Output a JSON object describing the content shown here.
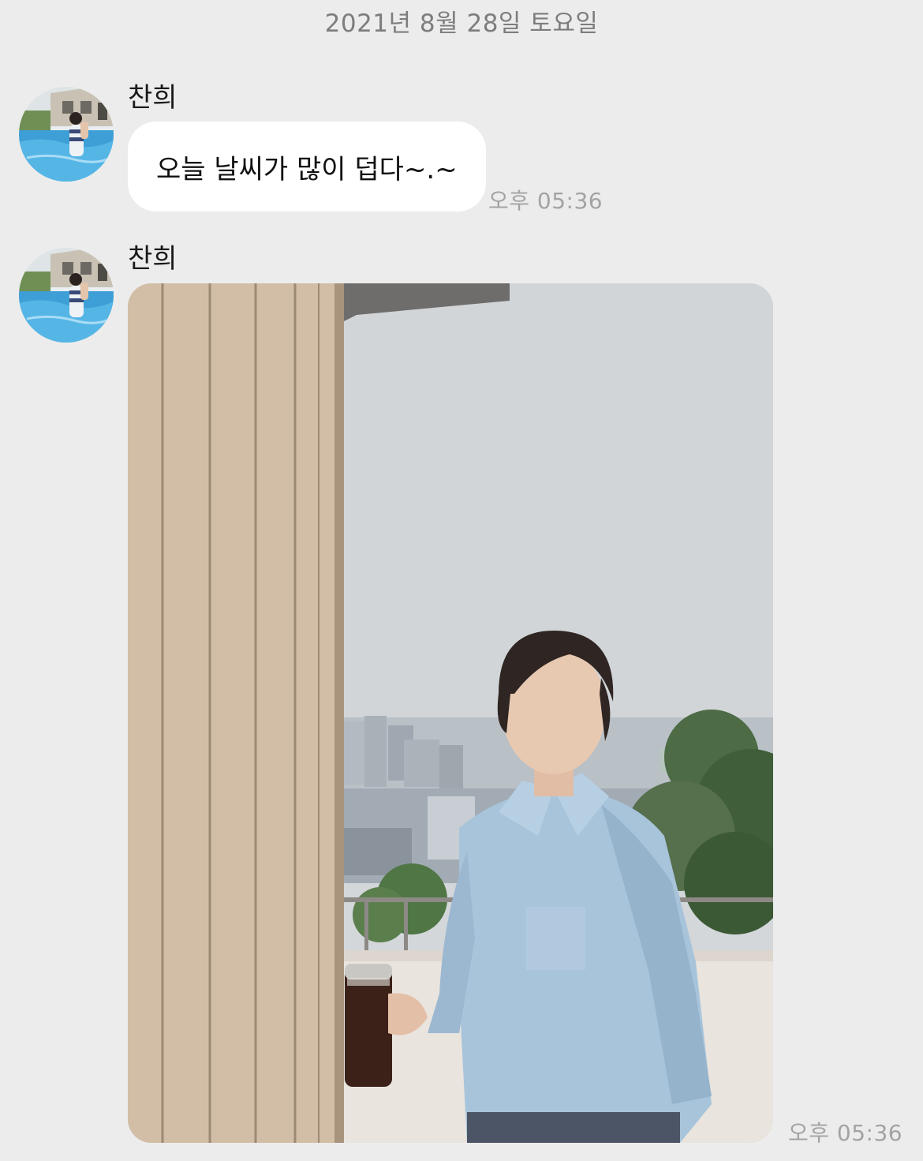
{
  "chat": {
    "date_divider": "2021년 8월 28일 토요일",
    "messages": [
      {
        "sender": "찬희",
        "avatar_icon": "profile-photo-pool",
        "type": "text",
        "text": "오늘 날씨가 많이 덥다~.~",
        "time": "오후 05:36"
      },
      {
        "sender": "찬희",
        "avatar_icon": "profile-photo-pool",
        "type": "image",
        "image_icon": "photo-balcony-portrait",
        "time": "오후 05:36"
      }
    ]
  },
  "colors": {
    "background": "#ececec",
    "bubble": "#ffffff",
    "meta_text": "#a3a3a3",
    "date_text": "#7d7d7d"
  }
}
